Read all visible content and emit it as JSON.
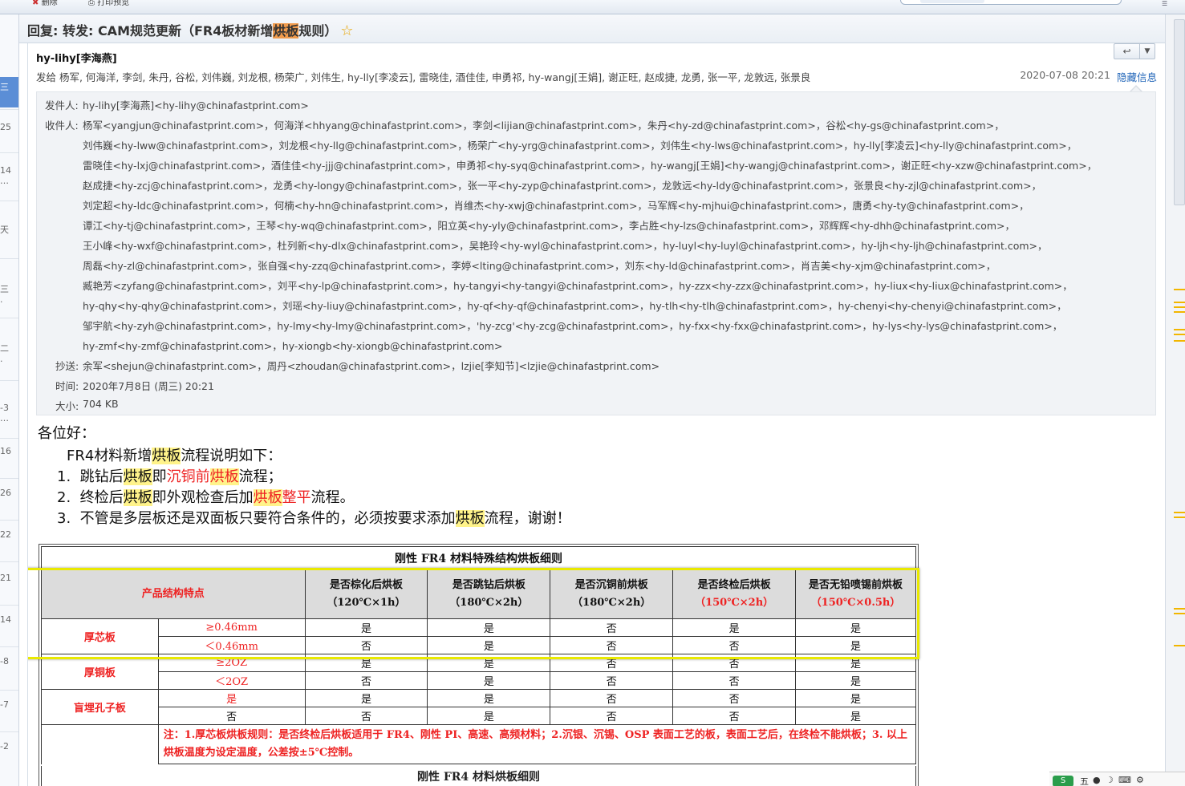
{
  "toolbar": {
    "btn1": "删除",
    "btn2": "打印预览"
  },
  "left_list": {
    "items": [
      "三",
      "25",
      "14",
      "天",
      "三",
      "二",
      "-3",
      "16",
      "26",
      "22",
      "21",
      "14",
      "-8",
      "-7",
      "-2"
    ]
  },
  "subject": {
    "pre": "回复: 转发: CAM规范更新（FR4板材新增",
    "highlight": "烘板",
    "post": "规则）",
    "star": "☆"
  },
  "header": {
    "sender": "hy-lihy[李海燕]",
    "send_to": "发给 杨军, 何海洋, 李剑, 朱丹, 谷松, 刘伟巍, 刘龙根, 杨荣广, 刘伟生, hy-lly[李凌云], 雷晓佳, 酒佳佳, 申勇祁, hy-wangj[王娟], 谢正旺, 赵成捷, 龙勇, 张一平, 龙敦远, 张景良",
    "datetime": "2020-07-08 20:21",
    "hide_info": "隐藏信息",
    "reply_icon": "↩",
    "more_icon": "▼"
  },
  "details": {
    "from_label": "发件人:",
    "from": "hy-lihy[李海燕]<hy-lihy@chinafastprint.com>",
    "to_label": "收件人:",
    "to_lines": [
      "杨军<yangjun@chinafastprint.com>，何海洋<hhyang@chinafastprint.com>，李剑<lijian@chinafastprint.com>，朱丹<hy-zd@chinafastprint.com>，谷松<hy-gs@chinafastprint.com>，",
      "刘伟巍<hy-lww@chinafastprint.com>，刘龙根<hy-llg@chinafastprint.com>，杨荣广<hy-yrg@chinafastprint.com>，刘伟生<hy-lws@chinafastprint.com>，hy-lly[李凌云]<hy-lly@chinafastprint.com>，",
      "雷晓佳<hy-lxj@chinafastprint.com>，酒佳佳<hy-jjj@chinafastprint.com>，申勇祁<hy-syq@chinafastprint.com>，hy-wangj[王娟]<hy-wangj@chinafastprint.com>，谢正旺<hy-xzw@chinafastprint.com>，",
      "赵成捷<hy-zcj@chinafastprint.com>，龙勇<hy-longy@chinafastprint.com>，张一平<hy-zyp@chinafastprint.com>，龙敦远<hy-ldy@chinafastprint.com>，张景良<hy-zjl@chinafastprint.com>，",
      "刘定超<hy-ldc@chinafastprint.com>，何楠<hy-hn@chinafastprint.com>，肖维杰<hy-xwj@chinafastprint.com>，马军辉<hy-mjhui@chinafastprint.com>，唐勇<hy-ty@chinafastprint.com>，",
      "谭江<hy-tj@chinafastprint.com>，王琴<hy-wq@chinafastprint.com>，阳立英<hy-yly@chinafastprint.com>，李占胜<hy-lzs@chinafastprint.com>，邓辉辉<hy-dhh@chinafastprint.com>，",
      "王小峰<hy-wxf@chinafastprint.com>，杜列新<hy-dlx@chinafastprint.com>，吴艳玲<hy-wyl@chinafastprint.com>，hy-luyl<hy-luyl@chinafastprint.com>，hy-ljh<hy-ljh@chinafastprint.com>，",
      "周磊<hy-zl@chinafastprint.com>，张自强<hy-zzq@chinafastprint.com>，李婷<lting@chinafastprint.com>，刘东<hy-ld@chinafastprint.com>，肖吉美<hy-xjm@chinafastprint.com>，",
      "臧艳芳<zyfang@chinafastprint.com>，刘平<hy-lp@chinafastprint.com>，hy-tangyi<hy-tangyi@chinafastprint.com>，hy-zzx<hy-zzx@chinafastprint.com>，hy-liux<hy-liux@chinafastprint.com>，",
      "hy-qhy<hy-qhy@chinafastprint.com>，刘瑶<hy-liuy@chinafastprint.com>，hy-qf<hy-qf@chinafastprint.com>，hy-tlh<hy-tlh@chinafastprint.com>，hy-chenyi<hy-chenyi@chinafastprint.com>，",
      "邹宇航<hy-zyh@chinafastprint.com>，hy-lmy<hy-lmy@chinafastprint.com>，'hy-zcg'<hy-zcg@chinafastprint.com>，hy-fxx<hy-fxx@chinafastprint.com>，hy-lys<hy-lys@chinafastprint.com>，",
      "hy-zmf<hy-zmf@chinafastprint.com>，hy-xiongb<hy-xiongb@chinafastprint.com>"
    ],
    "cc_label": "抄送:",
    "cc": "余军<shejun@chinafastprint.com>，周丹<zhoudan@chinafastprint.com>，lzjie[李知节]<lzjie@chinafastprint.com>",
    "time_label": "时间:",
    "time": "2020年7月8日 (周三) 20:21",
    "size_label": "大小:",
    "size": "704 KB"
  },
  "body": {
    "greeting": "各位好：",
    "intro_pre": "FR4材料新增",
    "intro_hl": "烘板",
    "intro_post": "流程说明如下：",
    "item1": {
      "num": "1.",
      "a": "跳钻后",
      "b": "烘板",
      "c": "即",
      "d": "沉铜前",
      "e": "烘板",
      "f": "流程；"
    },
    "item2": {
      "num": "2.",
      "a": "终检后",
      "b": "烘板",
      "c": "即外观检查后加",
      "d": "烘板",
      "e": "整平",
      "f": "流程。"
    },
    "item3": {
      "num": "3.",
      "a": "不管是多层板还是双面板只要符合条件的，必须按要求添加",
      "b": "烘板",
      "c": "流程，谢谢！"
    }
  },
  "table": {
    "title": "刚性 FR4 材料特殊结构烘板细则",
    "col0": "产品结构特点",
    "cols": [
      {
        "l1": "是否棕化后烘板",
        "l2": "（120℃×1h）",
        "red": false
      },
      {
        "l1": "是否跳钻后烘板",
        "l2": "（180℃×2h）",
        "red": false
      },
      {
        "l1": "是否沉铜前烘板",
        "l2": "（180℃×2h）",
        "red": false
      },
      {
        "l1": "是否终检后烘板",
        "l2": "（150℃×2h）",
        "red": true
      },
      {
        "l1": "是否无铅喷锡前烘板",
        "l2": "（150℃×0.5h）",
        "red": true
      }
    ],
    "groups": [
      {
        "name": "厚芯板",
        "rows": [
          {
            "spec": "≥0.46mm",
            "v": [
              "是",
              "是",
              "否",
              "是",
              "是"
            ]
          },
          {
            "spec": "＜0.46mm",
            "v": [
              "否",
              "是",
              "否",
              "否",
              "是"
            ]
          }
        ]
      },
      {
        "name": "厚铜板",
        "rows": [
          {
            "spec": "≥2OZ",
            "v": [
              "是",
              "是",
              "否",
              "否",
              "是"
            ]
          },
          {
            "spec": "＜2OZ",
            "v": [
              "否",
              "是",
              "否",
              "否",
              "是"
            ]
          }
        ]
      },
      {
        "name": "盲埋孔子板",
        "rows": [
          {
            "spec": "是",
            "v": [
              "是",
              "是",
              "否",
              "否",
              "是"
            ]
          },
          {
            "spec": "否",
            "v": [
              "否",
              "是",
              "否",
              "否",
              "是"
            ]
          }
        ]
      }
    ],
    "note": "注：1.厚芯板烘板规则：是否终检后烘板适用于 FR4、刚性 PI、高速、高频材料；2.沉银、沉锡、OSP 表面工艺的板，表面工艺后，在终检不能烘板；3. 以上烘板温度为设定温度，公差按±5℃控制。",
    "title2": "刚性 FR4 材料烘板细则"
  },
  "tray": {
    "ime": "S",
    "lang": "五",
    "dot": "●",
    "moon": "☽",
    "kb": "⌨",
    "more": "⚙"
  },
  "colors": {
    "highlight_yellow": "#fff38a",
    "highlight_orange": "#f19b4c",
    "red_text": "#ee2222",
    "link_blue": "#1f64b8",
    "callout_box": "#e9e900"
  }
}
